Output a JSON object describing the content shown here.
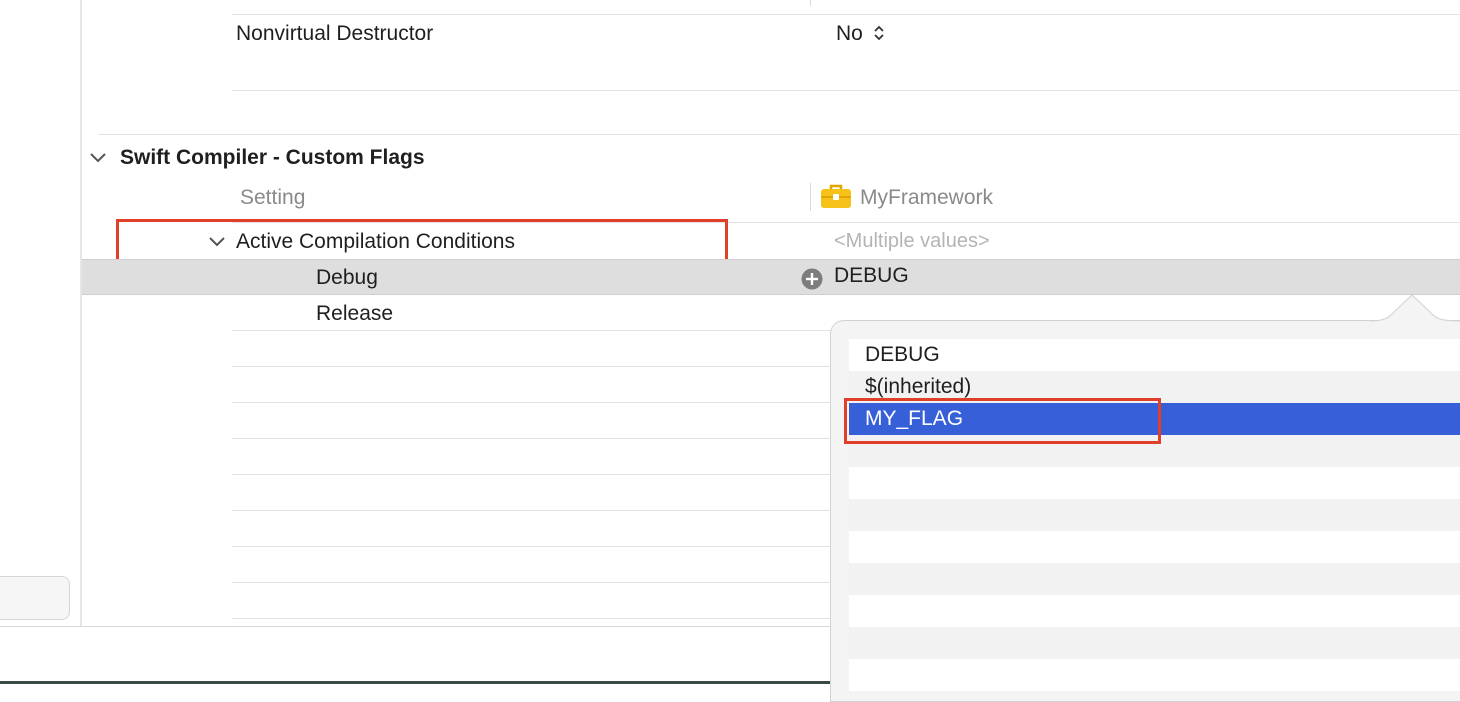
{
  "build_settings": {
    "previous_section": {
      "row": {
        "label": "Nonvirtual Destructor",
        "value": "No"
      }
    },
    "section": {
      "title": "Swift Compiler - Custom Flags",
      "column_header_setting": "Setting",
      "column_header_target": "MyFramework",
      "setting": {
        "label": "Active Compilation Conditions",
        "value": "<Multiple values>",
        "configs": [
          {
            "label": "Debug",
            "value": "DEBUG"
          },
          {
            "label": "Release",
            "value": ""
          }
        ]
      }
    }
  },
  "popup": {
    "items": [
      "DEBUG",
      "$(inherited)",
      "MY_FLAG"
    ],
    "selected_index": 2
  },
  "colors": {
    "selection": "#3760d8",
    "highlight_box": "#e0402a",
    "selected_row": "#dedede"
  },
  "icons": {
    "disclosure": "chevron-down-icon",
    "stepper": "up-down-chevron-icon",
    "add": "plus-circle-icon",
    "target": "toolbox-icon"
  }
}
